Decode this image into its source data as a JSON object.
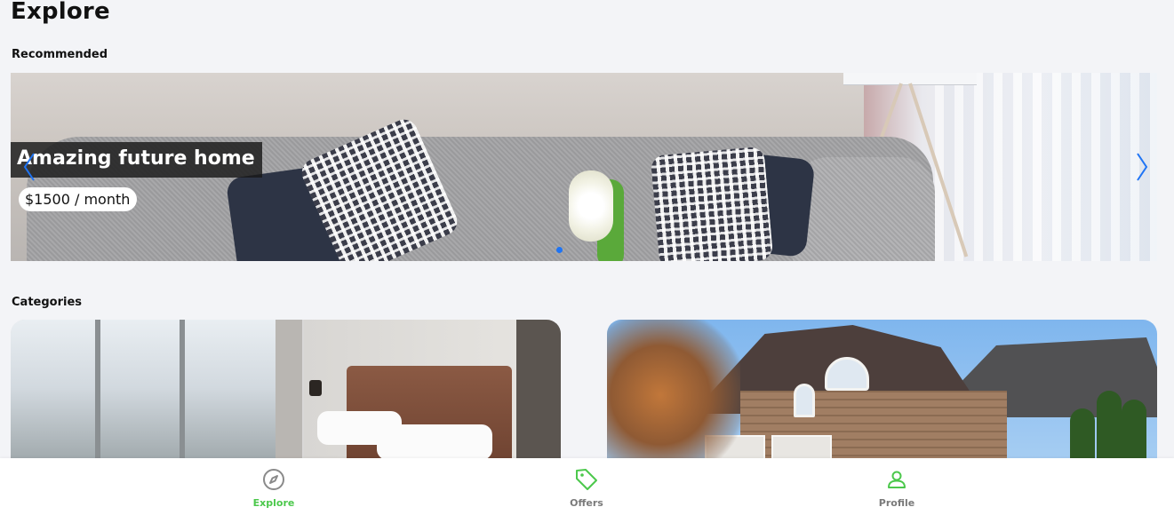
{
  "page": {
    "title": "Explore"
  },
  "sections": {
    "recommended": "Recommended",
    "categories": "Categories"
  },
  "carousel": {
    "title": "Amazing future home",
    "price": "$1500 / month",
    "slide_count": 1,
    "active_slide": 1,
    "arrow_color": "#1e74f5"
  },
  "categories": [
    {
      "image": "bedroom-interior"
    },
    {
      "image": "brick-house-exterior"
    }
  ],
  "bottom_nav": {
    "items": [
      {
        "label": "Explore",
        "icon": "compass-icon",
        "active": true
      },
      {
        "label": "Offers",
        "icon": "tag-icon",
        "active": false
      },
      {
        "label": "Profile",
        "icon": "person-icon",
        "active": false
      }
    ],
    "active_color": "#4cc84c",
    "inactive_color": "#7a7a7a"
  }
}
